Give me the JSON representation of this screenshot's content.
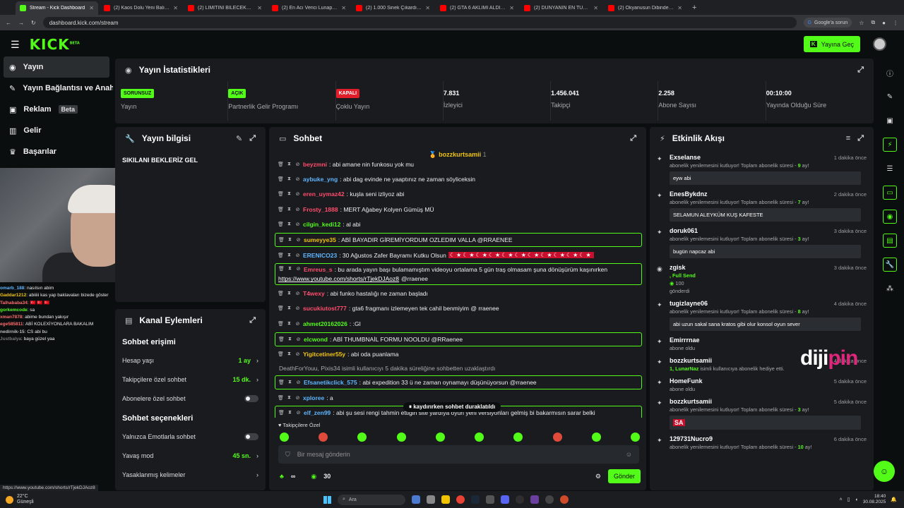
{
  "browser": {
    "tabs": [
      {
        "title": "Stream - Kick Dashboard",
        "active": true,
        "color": "#53fc18"
      },
      {
        "title": "(2) Kaos Dolu Yeni Balık Oyunu",
        "active": false,
        "color": "#ff0000"
      },
      {
        "title": "(2) LİMİTİNİ BİLECEKSİN | 5Sirlo",
        "active": false,
        "color": "#ff0000"
      },
      {
        "title": "(2) En Acı Verici Lunapark Ölüm",
        "active": false,
        "color": "#ff0000"
      },
      {
        "title": "(2) 1.000 Sinek Çıkardım... Ve K",
        "active": false,
        "color": "#ff0000"
      },
      {
        "title": "(2) GTA 6 AKLIMI ALDI! İLK OYN",
        "active": false,
        "color": "#ff0000"
      },
      {
        "title": "(2) DÜNYANIN EN TUHAF NÜK",
        "active": false,
        "color": "#ff0000"
      },
      {
        "title": "(2) Okyanusun Dibinde Oksijen",
        "active": false,
        "color": "#ff0000"
      }
    ],
    "new_tab": "+",
    "url": "dashboard.kick.com/stream",
    "google_chip": "Google'a sorun"
  },
  "header": {
    "logo": "KICK",
    "logo_tag": "BETA",
    "go_live": "Yayına Geç"
  },
  "nav": [
    {
      "label": "Yayın",
      "icon": "broadcast-icon",
      "active": true
    },
    {
      "label": "Yayın Bağlantısı ve Anahtar",
      "icon": "link-icon",
      "active": false
    },
    {
      "label": "Reklam",
      "icon": "ad-icon",
      "active": false,
      "badge": "Beta"
    },
    {
      "label": "Gelir",
      "icon": "money-icon",
      "active": false
    },
    {
      "label": "Başarılar",
      "icon": "trophy-icon",
      "active": false
    }
  ],
  "overlay_chat": [
    {
      "user": "omarb_188",
      "text": "nasılsın abim",
      "color": "#5fb6ff"
    },
    {
      "user": "Gaddar1212",
      "text": "abiiiii kas yap baklavaları bizede göster",
      "color": "#f1c40f"
    },
    {
      "user": "Talhababa34",
      "text": "🇹🇷 🇹🇷 🇹🇷",
      "color": "#ff6b6b"
    },
    {
      "user": "gorkemcode",
      "text": "sa",
      "color": "#53fc18"
    },
    {
      "user": "xman7878",
      "text": "abime bundan yakışır",
      "color": "#ff6b6b"
    },
    {
      "user": "ege585811",
      "text": "ABİ KOLEXİYONLARA BAKALIM",
      "color": "#ff6b6b"
    },
    {
      "user": "nedirnik-15",
      "text": "CS abi bu",
      "color": "#bbbbbb"
    },
    {
      "user": "Justbalya",
      "text": "baya güzel yaa",
      "color": "#777777"
    }
  ],
  "stats": {
    "title": "Yayın İstatistikleri",
    "items": [
      {
        "badge": "SORUNSUZ",
        "badge_bg": "#53fc18",
        "label": "Yayın"
      },
      {
        "badge": "AÇIK",
        "badge_bg": "#53fc18",
        "label": "Partnerlik Gelir Programı"
      },
      {
        "badge": "KAPALI",
        "badge_bg": "#e21d2a",
        "label": "Çoklu Yayın"
      },
      {
        "value": "7.831",
        "label": "İzleyici"
      },
      {
        "value": "1.456.041",
        "label": "Takipçi"
      },
      {
        "value": "2.258",
        "label": "Abone Sayısı"
      },
      {
        "value": "00:10:00",
        "label": "Yayında Olduğu Süre"
      }
    ]
  },
  "stream_info": {
    "title": "Yayın bilgisi",
    "stream_title": "SIKILANI BEKLERİZ GEL"
  },
  "channel_actions": {
    "title": "Kanal Eylemleri",
    "access_title": "Sohbet erişimi",
    "access": [
      {
        "label": "Hesap yaşı",
        "value": "1 ay"
      },
      {
        "label": "Takipçilere özel sohbet",
        "value": "15 dk."
      },
      {
        "label": "Abonelere özel sohbet",
        "toggle": true
      }
    ],
    "options_title": "Sohbet seçenekleri",
    "options": [
      {
        "label": "Yalnızca Emotlarla sohbet",
        "toggle": true
      },
      {
        "label": "Yavaş mod",
        "value": "45 sn."
      },
      {
        "label": "Yasaklanmış kelimeler",
        "value": ""
      }
    ]
  },
  "chat": {
    "title": "Sohbet",
    "pinned_user": "bozzkurtsamii",
    "pinned_count": "1",
    "messages": [
      {
        "user": "beyzmni",
        "color": "#ff4d6d",
        "text": ": abi amane nin funkosu yok mu"
      },
      {
        "user": "aybuke_yng",
        "color": "#5fb6ff",
        "text": ": abi dag evinde ne yaaptınız ne zaman söyliceksin"
      },
      {
        "user": "eren_uymaz42",
        "color": "#ff4d6d",
        "text": ": kuşla seni izliyoz abi"
      },
      {
        "user": "Frosty_1888",
        "color": "#ff4d6d",
        "text": ": MERT Ağabey Kolyen Gümüş MÜ"
      },
      {
        "user": "cilgin_kedi12",
        "color": "#53fc18",
        "text": ": al abi"
      },
      {
        "user": "sumeyye35",
        "color": "#f1c40f",
        "text": ": ABİ BAYADIR GİREMİYORDUM OZLEDIM VALLA @RRAENEE",
        "hl": true
      },
      {
        "user": "ERENICO23",
        "color": "#5fb6ff",
        "text": ": 30 Ağustos Zafer Bayramı Kutku Olsun",
        "flags": "☾★☾★☾★☾★☾★☾★☾★☾★☾★☾★☾★"
      },
      {
        "user": "Emreus_s",
        "color": "#ff4d6d",
        "text": ": bu arada yayın başı bulamamıştım videoyu ortalama 5 gün traş olmasam şuna dönüşürüm kaşınırken",
        "link": "https://www.youtube.com/shorts/rTjekDJAoz8",
        "tail": " @rraenee",
        "hl": true,
        "wrap": true
      },
      {
        "user": "T4wexy",
        "color": "#ff4d6d",
        "text": ": abi funko hastalığı ne zaman başladı"
      },
      {
        "user": "sucukiutost777",
        "color": "#ff4d6d",
        "text": ": gta6 fragmanı izlemeyen tek cahil benmiyim @ rraenee"
      },
      {
        "user": "ahmet20162026",
        "color": "#53fc18",
        "text": ": :GI"
      },
      {
        "user": "elcwond",
        "color": "#53fc18",
        "text": ": ABİ THUMBNAİL FORMU NOOLDU @RRaenee",
        "hl": true
      },
      {
        "user": "Yigitcetiner55y",
        "color": "#f1c40f",
        "text": ": abi oda puanlama"
      }
    ],
    "system": "DeathForYouu, Pixis34 isimli kullanıcıyı 5 dakika süreliğine sohbetten uzaklaştırdı",
    "messages2": [
      {
        "user": "Efsanetikclick_575",
        "color": "#5fb6ff",
        "text": ": abi expedition 33 ü ne zaman oynamayı düşünüyorsun @rraenee",
        "hl": true
      },
      {
        "user": "xploree",
        "color": "#5fb6ff",
        "text": ": a"
      },
      {
        "user": "elf_zen99",
        "color": "#5fb6ff",
        "text": ": abi şu sesi rengi tahmin ettiğin site yardıya oyun yeni versiyonları gelmiş bi bakarmısın sarar belki",
        "hl": true
      }
    ],
    "paused": "kaydırırken sohbet duraklatıldı",
    "followers_only": "Takipçilere Özel",
    "placeholder": "Bir mesaj gönderin",
    "count_left": "∞",
    "count_right": "30",
    "send": "Gönder"
  },
  "activity": {
    "title": "Etkinlik Akışı",
    "events": [
      {
        "user": "Exselanse",
        "time": "1 dakika önce",
        "desc_pre": "abonelik yenilemesini kutluyor! Toplam abonelik süresi - ",
        "desc_val": "9",
        "desc_post": " ay!",
        "msg": "eyw abi"
      },
      {
        "user": "EnesBykdnz",
        "time": "2 dakika önce",
        "desc_pre": "abonelik yenilemesini kutluyor! Toplam abonelik süresi - ",
        "desc_val": "7",
        "desc_post": " ay!",
        "msg": "SELAMUN ALEYKÜM KUŞ KAFESTE"
      },
      {
        "user": "doruk061",
        "time": "3 dakika önce",
        "desc_pre": "abonelik yenilemesini kutluyor! Toplam abonelik süresi - ",
        "desc_val": "3",
        "desc_post": " ay!",
        "msg": "bugün napcaz abi"
      },
      {
        "user": "zgisk",
        "time": "3 dakika önce",
        "desc_pre": "",
        "desc_val": ", Full Send",
        "desc_post": "",
        "kicks": "100",
        "kicks_label": "gönderdi"
      },
      {
        "user": "tugizlayne06",
        "time": "4 dakika önce",
        "desc_pre": "abonelik yenilemesini kutluyor! Toplam abonelik süresi - ",
        "desc_val": "8",
        "desc_post": " ay!",
        "msg": "abi uzun sakal sana kratos gibi olur konsol oyun sever"
      },
      {
        "user": "Emirrrnae",
        "time": "",
        "desc_pre": "abone oldu",
        "desc_val": "",
        "desc_post": ""
      },
      {
        "user": "bozzkurtsamii",
        "time": "4 dakika önce",
        "desc_pre": "",
        "desc_val": "1, LunarNaz",
        "desc_post": " isimli kullanıcıya abonelik hediye etti."
      },
      {
        "user": "HomeFunk",
        "time": "5 dakika önce",
        "desc_pre": "abone oldu",
        "desc_val": "",
        "desc_post": ""
      },
      {
        "user": "bozzkurtsamii",
        "time": "5 dakika önce",
        "desc_pre": "abonelik yenilemesini kutluyor! Toplam abonelik süresi - ",
        "desc_val": "3",
        "desc_post": " ay!",
        "msg": "SA",
        "flag": true
      },
      {
        "user": "129731Nucro9",
        "time": "6 dakika önce",
        "desc_pre": "abonelik yenilemesini kutluyor! Toplam abonelik süresi - ",
        "desc_val": "10",
        "desc_post": " ay!"
      }
    ]
  },
  "watermark": {
    "pre": "diji",
    "post": "pin"
  },
  "status_link": "https://www.youtube.com/shorts/rTjekDJAoz8",
  "taskbar": {
    "temp": "22°C",
    "weather": "Güneşli",
    "search": "Ara",
    "time": "18:40",
    "date": "30.08.2025"
  },
  "colors": {
    "accent": "#53fc18",
    "panel": "#191b1f",
    "bg": "#0b0e0f",
    "danger": "#e21d2a"
  }
}
